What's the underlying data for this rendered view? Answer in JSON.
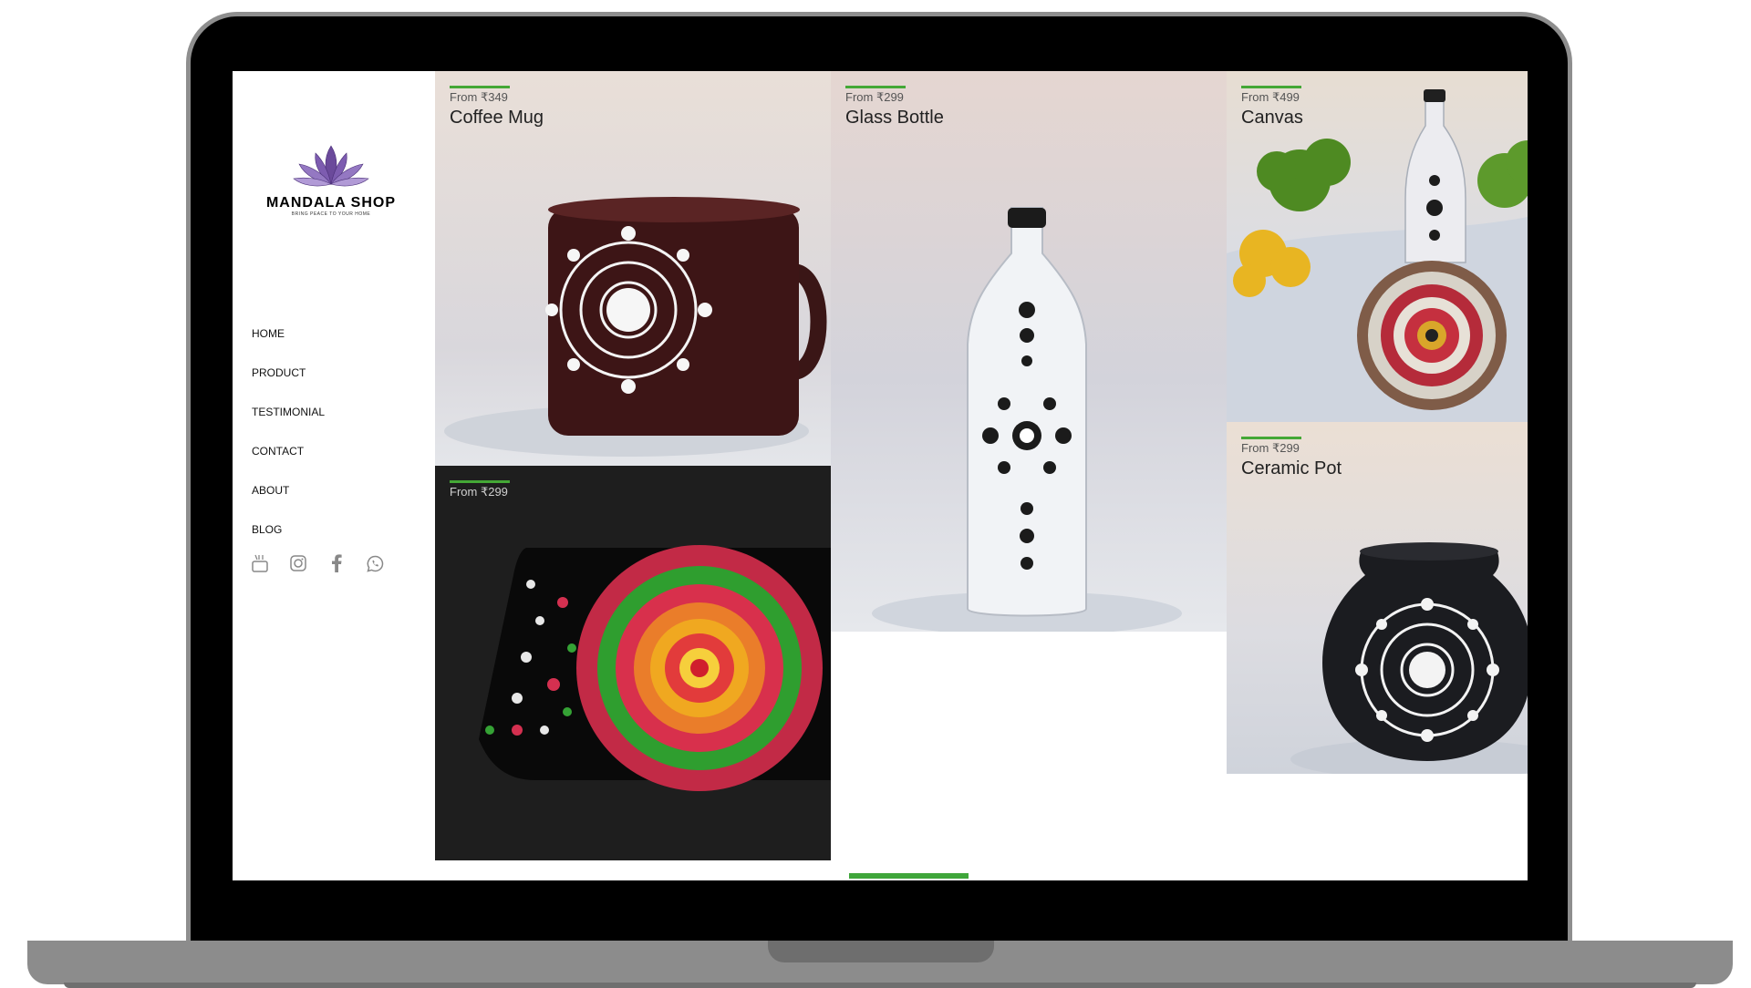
{
  "brand": {
    "name": "MANDALA SHOP",
    "tagline": "BRING PEACE TO YOUR HOME"
  },
  "nav": {
    "items": [
      "HOME",
      "PRODUCT",
      "TESTIMONIAL",
      "CONTACT",
      "ABOUT",
      "BLOG"
    ]
  },
  "social": {
    "icons": [
      "youtube-icon",
      "instagram-icon",
      "facebook-icon",
      "whatsapp-icon"
    ]
  },
  "products": [
    {
      "price": "From ₹349",
      "name": "Coffee Mug"
    },
    {
      "price": "From ₹299",
      "name": "Glass Bottle"
    },
    {
      "price": "From ₹499",
      "name": "Canvas"
    },
    {
      "price": "From ₹299",
      "name": ""
    },
    {
      "price": "From ₹299",
      "name": "Ceramic Pot"
    }
  ],
  "colors": {
    "accent": "#44a836",
    "frame": "#8e8e8e",
    "bezel": "#000000"
  }
}
